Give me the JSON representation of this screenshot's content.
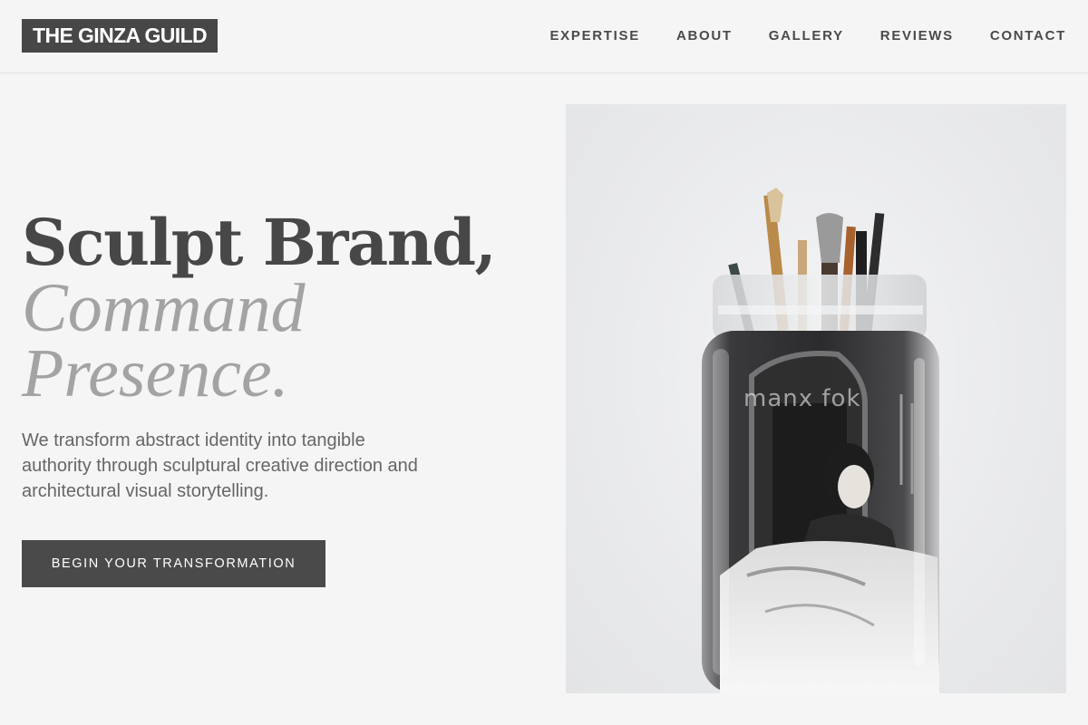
{
  "brand": {
    "logo": "THE GINZA GUILD"
  },
  "nav": {
    "items": [
      {
        "label": "EXPERTISE"
      },
      {
        "label": "ABOUT"
      },
      {
        "label": "GALLERY"
      },
      {
        "label": "REVIEWS"
      },
      {
        "label": "CONTACT"
      }
    ]
  },
  "hero": {
    "line1": "Sculpt Brand,",
    "line2": "Command",
    "line3": "Presence.",
    "lede": "We transform abstract identity into tangible authority through sculptural creative direction and architectural visual storytelling.",
    "cta": "BEGIN YOUR TRANSFORMATION"
  },
  "photo": {
    "watermark": "manx fok",
    "subject": "glass jar with paint brushes"
  },
  "colors": {
    "background": "#f5f5f5",
    "primary": "#474747",
    "muted": "#a3a3a3",
    "body_text": "#666666"
  }
}
